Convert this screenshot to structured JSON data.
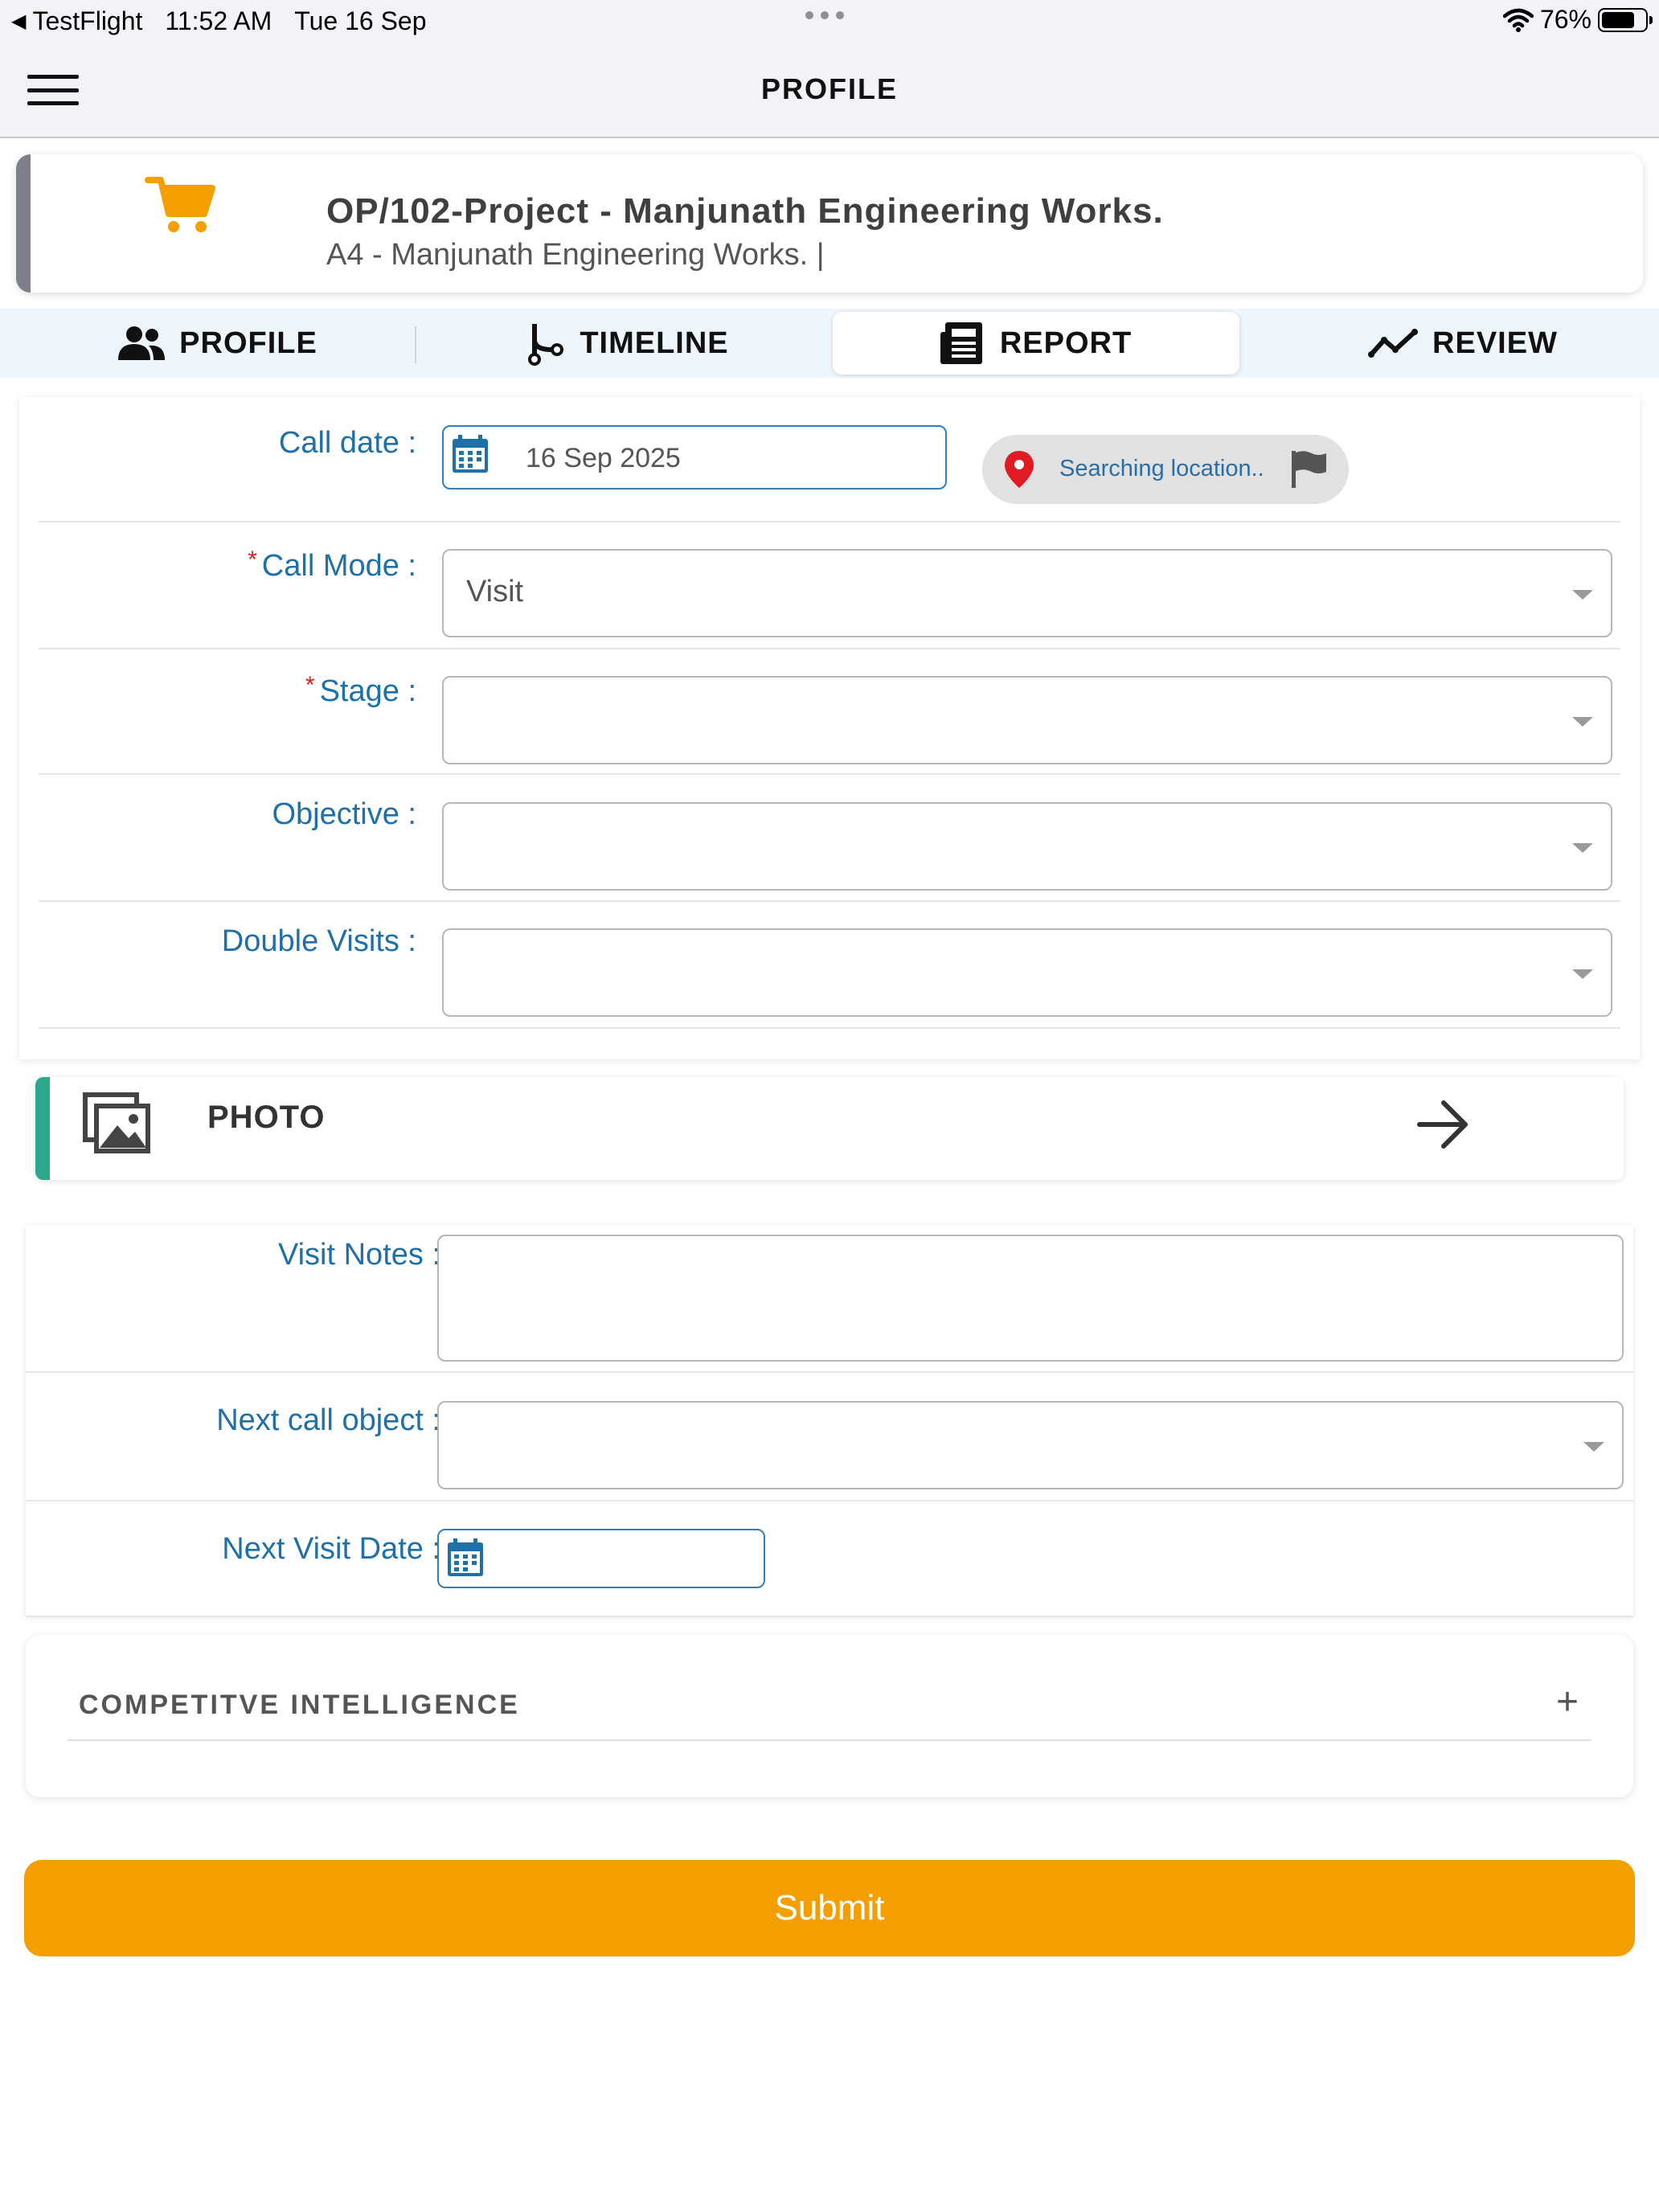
{
  "status_bar": {
    "back_app": "TestFlight",
    "time": "11:52 AM",
    "date": "Tue 16 Sep",
    "battery": "76%"
  },
  "nav": {
    "title": "PROFILE"
  },
  "header": {
    "title": "OP/102-Project - Manjunath Engineering Works.",
    "subtitle": "A4 - Manjunath Engineering Works. |",
    "icon": "cart-icon"
  },
  "tabs": [
    {
      "label": "PROFILE",
      "icon": "users-icon",
      "active": false
    },
    {
      "label": "TIMELINE",
      "icon": "branch-icon",
      "active": false
    },
    {
      "label": "REPORT",
      "icon": "newspaper-icon",
      "active": true
    },
    {
      "label": "REVIEW",
      "icon": "trend-icon",
      "active": false
    }
  ],
  "form": {
    "call_date": {
      "label": "Call date :",
      "value": "16 Sep 2025"
    },
    "location": {
      "text": "Searching location.."
    },
    "call_mode": {
      "label": "Call Mode :",
      "value": "Visit",
      "required": true
    },
    "stage": {
      "label": "Stage :",
      "value": "",
      "required": true
    },
    "objective": {
      "label": "Objective :",
      "value": ""
    },
    "double_visits": {
      "label": "Double Visits :",
      "value": ""
    }
  },
  "photo": {
    "label": "PHOTO"
  },
  "notes": {
    "visit_notes": {
      "label": "Visit Notes :",
      "value": ""
    },
    "next_call_object": {
      "label": "Next call object :",
      "value": ""
    },
    "next_visit_date": {
      "label": "Next Visit Date :",
      "value": ""
    }
  },
  "competitive": {
    "label": "COMPETITVE INTELLIGENCE",
    "toggle": "+"
  },
  "submit": {
    "label": "Submit"
  },
  "colors": {
    "accent_orange": "#f59e00",
    "label_blue": "#1f6fa8",
    "required_red": "#e02020",
    "photo_accent": "#2ba98a"
  }
}
